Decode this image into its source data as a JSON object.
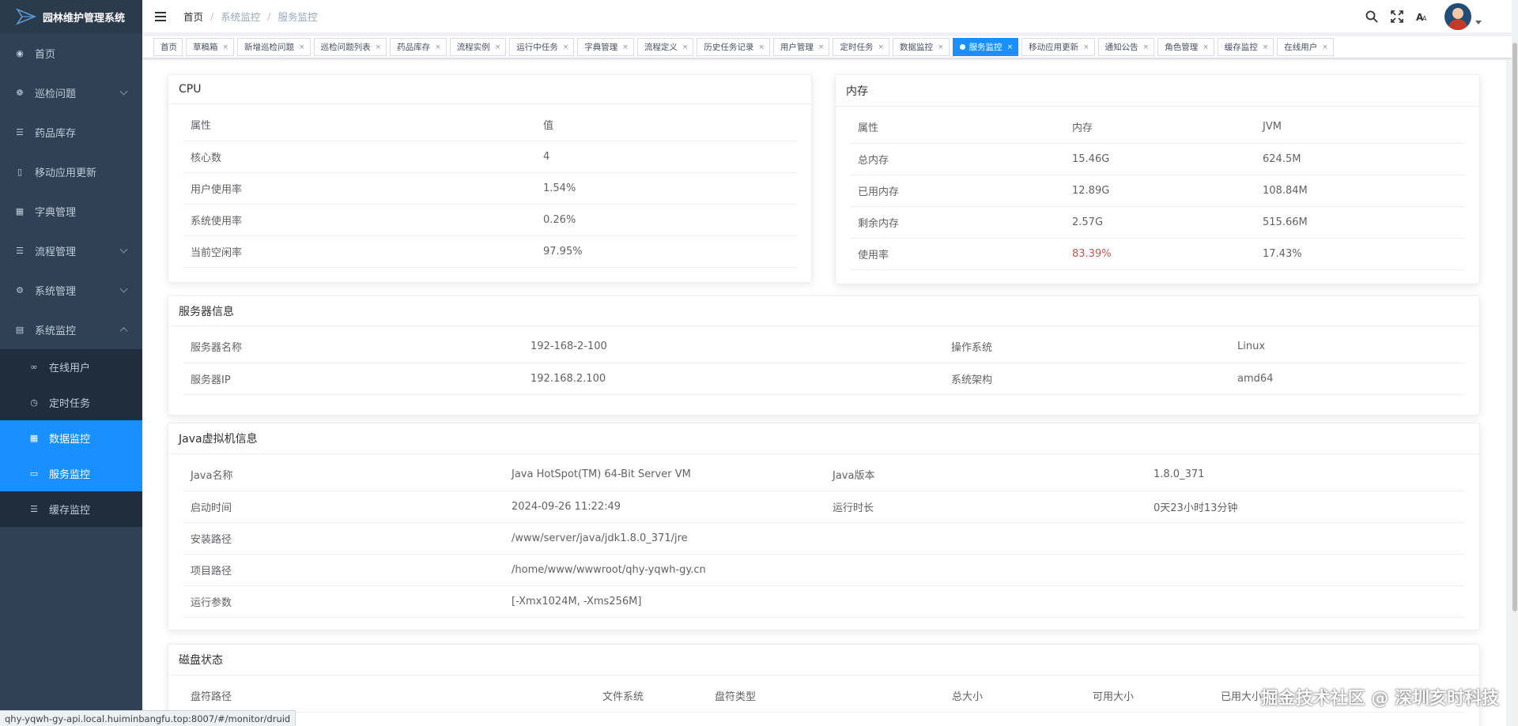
{
  "app": {
    "title": "园林维护管理系统"
  },
  "sidebar": {
    "items": [
      {
        "label": "首页"
      },
      {
        "label": "巡检问题"
      },
      {
        "label": "药品库存"
      },
      {
        "label": "移动应用更新"
      },
      {
        "label": "字典管理"
      },
      {
        "label": "流程管理"
      },
      {
        "label": "系统管理"
      },
      {
        "label": "系统监控"
      }
    ],
    "submenu": [
      {
        "label": "在线用户"
      },
      {
        "label": "定时任务"
      },
      {
        "label": "数据监控"
      },
      {
        "label": "服务监控"
      },
      {
        "label": "缓存监控"
      }
    ]
  },
  "breadcrumb": [
    "首页",
    "系统监控",
    "服务监控"
  ],
  "tags": [
    "首页",
    "草稿箱",
    "新增巡检问题",
    "巡检问题列表",
    "药品库存",
    "流程实例",
    "运行中任务",
    "字典管理",
    "流程定义",
    "历史任务记录",
    "用户管理",
    "定时任务",
    "数据监控",
    "服务监控",
    "移动应用更新",
    "通知公告",
    "角色管理",
    "缓存监控",
    "在线用户"
  ],
  "active_tag": "服务监控",
  "cpu": {
    "title": "CPU",
    "headers": [
      "属性",
      "值"
    ],
    "rows": [
      [
        "核心数",
        "4"
      ],
      [
        "用户使用率",
        "1.54%"
      ],
      [
        "系统使用率",
        "0.26%"
      ],
      [
        "当前空闲率",
        "97.95%"
      ]
    ]
  },
  "memory": {
    "title": "内存",
    "headers": [
      "属性",
      "内存",
      "JVM"
    ],
    "rows": [
      [
        "总内存",
        "15.46G",
        "624.5M"
      ],
      [
        "已用内存",
        "12.89G",
        "108.84M"
      ],
      [
        "剩余内存",
        "2.57G",
        "515.66M"
      ],
      [
        "使用率",
        "83.39%",
        "17.43%"
      ]
    ],
    "warn_color": "#c4584c"
  },
  "server": {
    "title": "服务器信息",
    "rows": [
      [
        "服务器名称",
        "192-168-2-100",
        "操作系统",
        "Linux"
      ],
      [
        "服务器IP",
        "192.168.2.100",
        "系统架构",
        "amd64"
      ]
    ]
  },
  "jvm": {
    "title": "Java虚拟机信息",
    "rows": [
      [
        "Java名称",
        "Java HotSpot(TM) 64-Bit Server VM",
        "Java版本",
        "1.8.0_371"
      ],
      [
        "启动时间",
        "2024-09-26 11:22:49",
        "运行时长",
        "0天23小时13分钟"
      ],
      [
        "安装路径",
        "/www/server/java/jdk1.8.0_371/jre"
      ],
      [
        "项目路径",
        "/home/www/wwwroot/qhy-yqwh-gy.cn"
      ],
      [
        "运行参数",
        "[-Xmx1024M, -Xms256M]"
      ]
    ]
  },
  "disk": {
    "title": "磁盘状态",
    "headers": [
      "盘符路径",
      "文件系统",
      "盘符类型",
      "总大小",
      "可用大小",
      "已用大小"
    ]
  },
  "status_url": "qhy-yqwh-gy-api.local.huiminbangfu.top:8007/#/monitor/druid",
  "watermark": "掘金技术社区 @ 深圳亥时科技",
  "colors": {
    "sidebar_bg": "#304156",
    "accent": "#1890ff"
  }
}
